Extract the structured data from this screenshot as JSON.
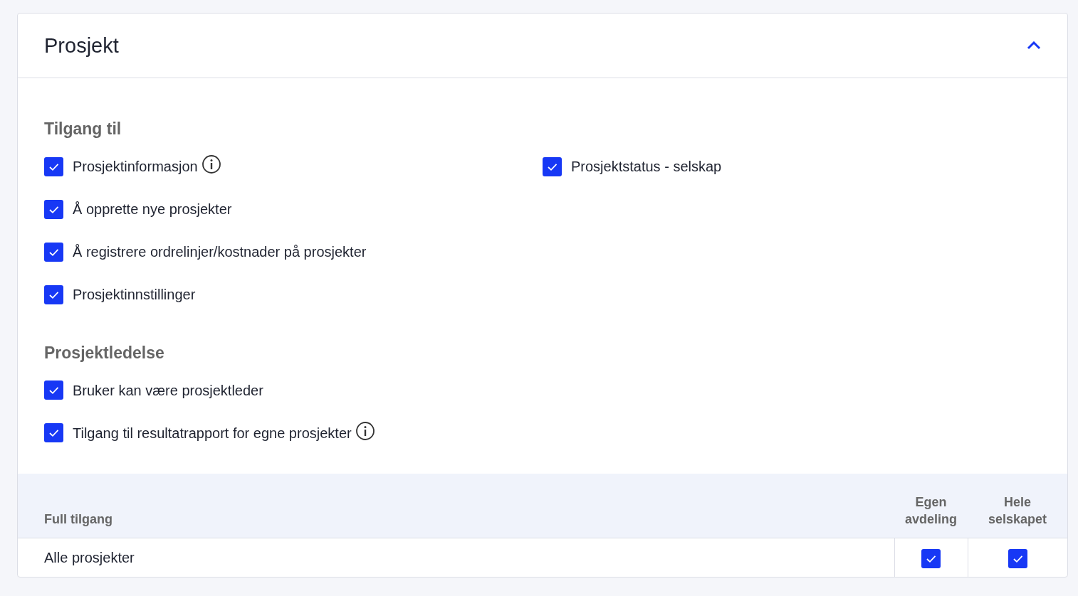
{
  "panel": {
    "title": "Prosjekt",
    "expanded": true
  },
  "sections": [
    {
      "heading": "Tilgang til",
      "columns": [
        [
          {
            "label": "Prosjektinformasjon",
            "checked": true,
            "info": true
          },
          {
            "label": "Å opprette nye prosjekter",
            "checked": true,
            "info": false
          },
          {
            "label": "Å registrere ordrelinjer/kostnader på prosjekter",
            "checked": true,
            "info": false
          },
          {
            "label": "Prosjektinnstillinger",
            "checked": true,
            "info": false
          }
        ],
        [
          {
            "label": "Prosjektstatus - selskap",
            "checked": true,
            "info": false
          }
        ]
      ]
    },
    {
      "heading": "Prosjektledelse",
      "columns": [
        [
          {
            "label": "Bruker kan være prosjektleder",
            "checked": true,
            "info": false
          },
          {
            "label": "Tilgang til resultatrapport for egne prosjekter",
            "checked": true,
            "info": true
          }
        ]
      ]
    }
  ],
  "table": {
    "columns": [
      "Full tilgang",
      "Egen avdeling",
      "Hele selskapet"
    ],
    "rows": [
      {
        "label": "Alle prosjekter",
        "cells": [
          {
            "checked": true
          },
          {
            "checked": true
          }
        ]
      }
    ]
  }
}
